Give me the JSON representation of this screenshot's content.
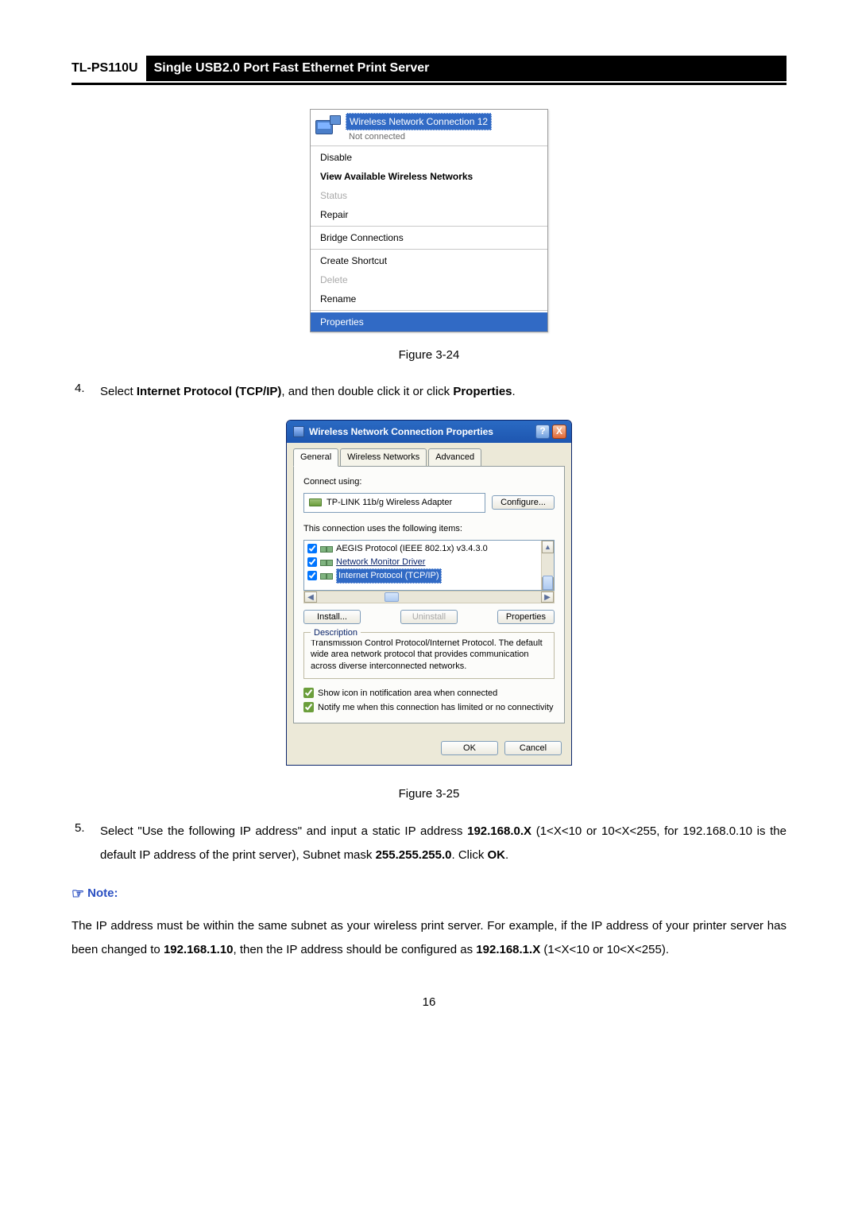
{
  "header": {
    "model": "TL-PS110U",
    "title": "Single USB2.0 Port Fast Ethernet Print Server"
  },
  "ctx_menu": {
    "conn_title": "Wireless Network Connection 12",
    "conn_status": "Not connected",
    "items": {
      "disable": "Disable",
      "view": "View Available Wireless Networks",
      "status": "Status",
      "repair": "Repair",
      "bridge": "Bridge Connections",
      "shortcut": "Create Shortcut",
      "delete": "Delete",
      "rename": "Rename",
      "properties": "Properties"
    }
  },
  "fig1_caption": "Figure 3-24",
  "step4": {
    "num": "4.",
    "pre": "Select ",
    "bold1": "Internet Protocol (TCP/IP)",
    "mid": ", and then double click it or click ",
    "bold2": "Properties",
    "post": "."
  },
  "dialog": {
    "title": "Wireless Network Connection Properties",
    "help": "?",
    "close": "X",
    "tabs": {
      "general": "General",
      "wireless": "Wireless Networks",
      "advanced": "Advanced"
    },
    "connect_using": "Connect using:",
    "adapter": "TP-LINK 11b/g Wireless Adapter",
    "configure": "Configure...",
    "uses_items": "This connection uses the following items:",
    "item_aegis": "AEGIS Protocol (IEEE 802.1x) v3.4.3.0",
    "item_nmd": "Network Monitor Driver",
    "item_tcpip": "Internet Protocol (TCP/IP)",
    "install": "Install...",
    "uninstall": "Uninstall",
    "properties": "Properties",
    "desc_title": "Description",
    "desc_text": "Transmission Control Protocol/Internet Protocol. The default wide area network protocol that provides communication across diverse interconnected networks.",
    "show_icon": "Show icon in notification area when connected",
    "notify": "Notify me when this connection has limited or no connectivity",
    "ok": "OK",
    "cancel": "Cancel"
  },
  "fig2_caption": "Figure 3-25",
  "step5": {
    "num": "5.",
    "t1": "Select \"Use the following IP address\" and input a static IP address ",
    "b1": "192.168.0.X",
    "t2": " (1<X<10 or 10<X<255, for 192.168.0.10 is the default IP address of the print server), Subnet mask ",
    "b2": "255.255.255.0",
    "t3": ". Click ",
    "b3": "OK",
    "t4": "."
  },
  "note": {
    "heading": "Note:",
    "t1": "The IP address must be within the same subnet as your wireless print server. For example, if the IP address of your printer server has been changed to ",
    "b1": "192.168.1.10",
    "t2": ", then the IP address should be configured as ",
    "b2": "192.168.1.X",
    "t3": " (1<X<10 or 10<X<255)."
  },
  "page_number": "16"
}
